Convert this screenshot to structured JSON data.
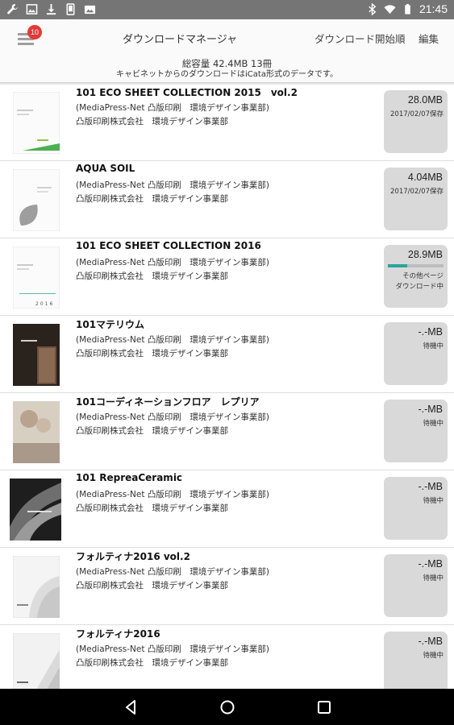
{
  "status_bar": {
    "left_icons": [
      "wrench-icon",
      "image-icon",
      "download-icon",
      "phone-icon",
      "photo-icon"
    ],
    "right_icons": [
      "bluetooth-icon",
      "wifi-icon",
      "battery-icon"
    ],
    "time": "21:45"
  },
  "app_bar": {
    "badge_count": "10",
    "title": "ダウンロードマネージャ",
    "sort_label": "ダウンロード開始順",
    "edit_label": "編集"
  },
  "summary": {
    "total": "総容量 42.4MB 13冊",
    "note": "キャビネットからのダウンロードはiCata形式のデータです。"
  },
  "items": [
    {
      "title": "101 ECO SHEET COLLECTION 2015　vol.2",
      "publisher1": "(MediaPress-Net 凸版印刷　環境デザイン事業部)",
      "publisher2": "凸版印刷株式会社　環境デザイン事業部",
      "size": "28.0MB",
      "status": "2017/02/07保存"
    },
    {
      "title": "AQUA SOIL",
      "publisher1": "(MediaPress-Net 凸版印刷　環境デザイン事業部)",
      "publisher2": "凸版印刷株式会社　環境デザイン事業部",
      "size": "4.04MB",
      "status": "2017/02/07保存"
    },
    {
      "title": "101 ECO SHEET COLLECTION 2016",
      "publisher1": "(MediaPress-Net 凸版印刷　環境デザイン事業部)",
      "publisher2": "凸版印刷株式会社　環境デザイン事業部",
      "size": "28.9MB",
      "status_line1": "その他ページ",
      "status_line2": "ダウンロード中",
      "progress": 0.35
    },
    {
      "title": "101マテリウム",
      "publisher1": "(MediaPress-Net 凸版印刷　環境デザイン事業部)",
      "publisher2": "凸版印刷株式会社　環境デザイン事業部",
      "size": "-.-MB",
      "status": "待機中"
    },
    {
      "title": "101コーディネーションフロア　レプリア",
      "publisher1": "(MediaPress-Net 凸版印刷　環境デザイン事業部)",
      "publisher2": "凸版印刷株式会社　環境デザイン事業部",
      "size": "-.-MB",
      "status": "待機中"
    },
    {
      "title": "101 RepreaCeramic",
      "publisher1": "(MediaPress-Net 凸版印刷　環境デザイン事業部)",
      "publisher2": "凸版印刷株式会社　環境デザイン事業部",
      "size": "-.-MB",
      "status": "待機中"
    },
    {
      "title": "フォルティナ2016 vol.2",
      "publisher1": "(MediaPress-Net 凸版印刷　環境デザイン事業部)",
      "publisher2": "凸版印刷株式会社　環境デザイン事業部",
      "size": "-.-MB",
      "status": "待機中"
    },
    {
      "title": "フォルティナ2016",
      "publisher1": "(MediaPress-Net 凸版印刷　環境デザイン事業部)",
      "publisher2": "凸版印刷株式会社　環境デザイン事業部",
      "size": "-.-MB",
      "status": "待機中"
    }
  ],
  "nav_bar": [
    "back-icon",
    "home-icon",
    "recents-icon"
  ],
  "colors": {
    "status_bar": "#757575",
    "badge": "#e53935",
    "progress": "#26a69a",
    "status_box": "#d9d9d9"
  }
}
